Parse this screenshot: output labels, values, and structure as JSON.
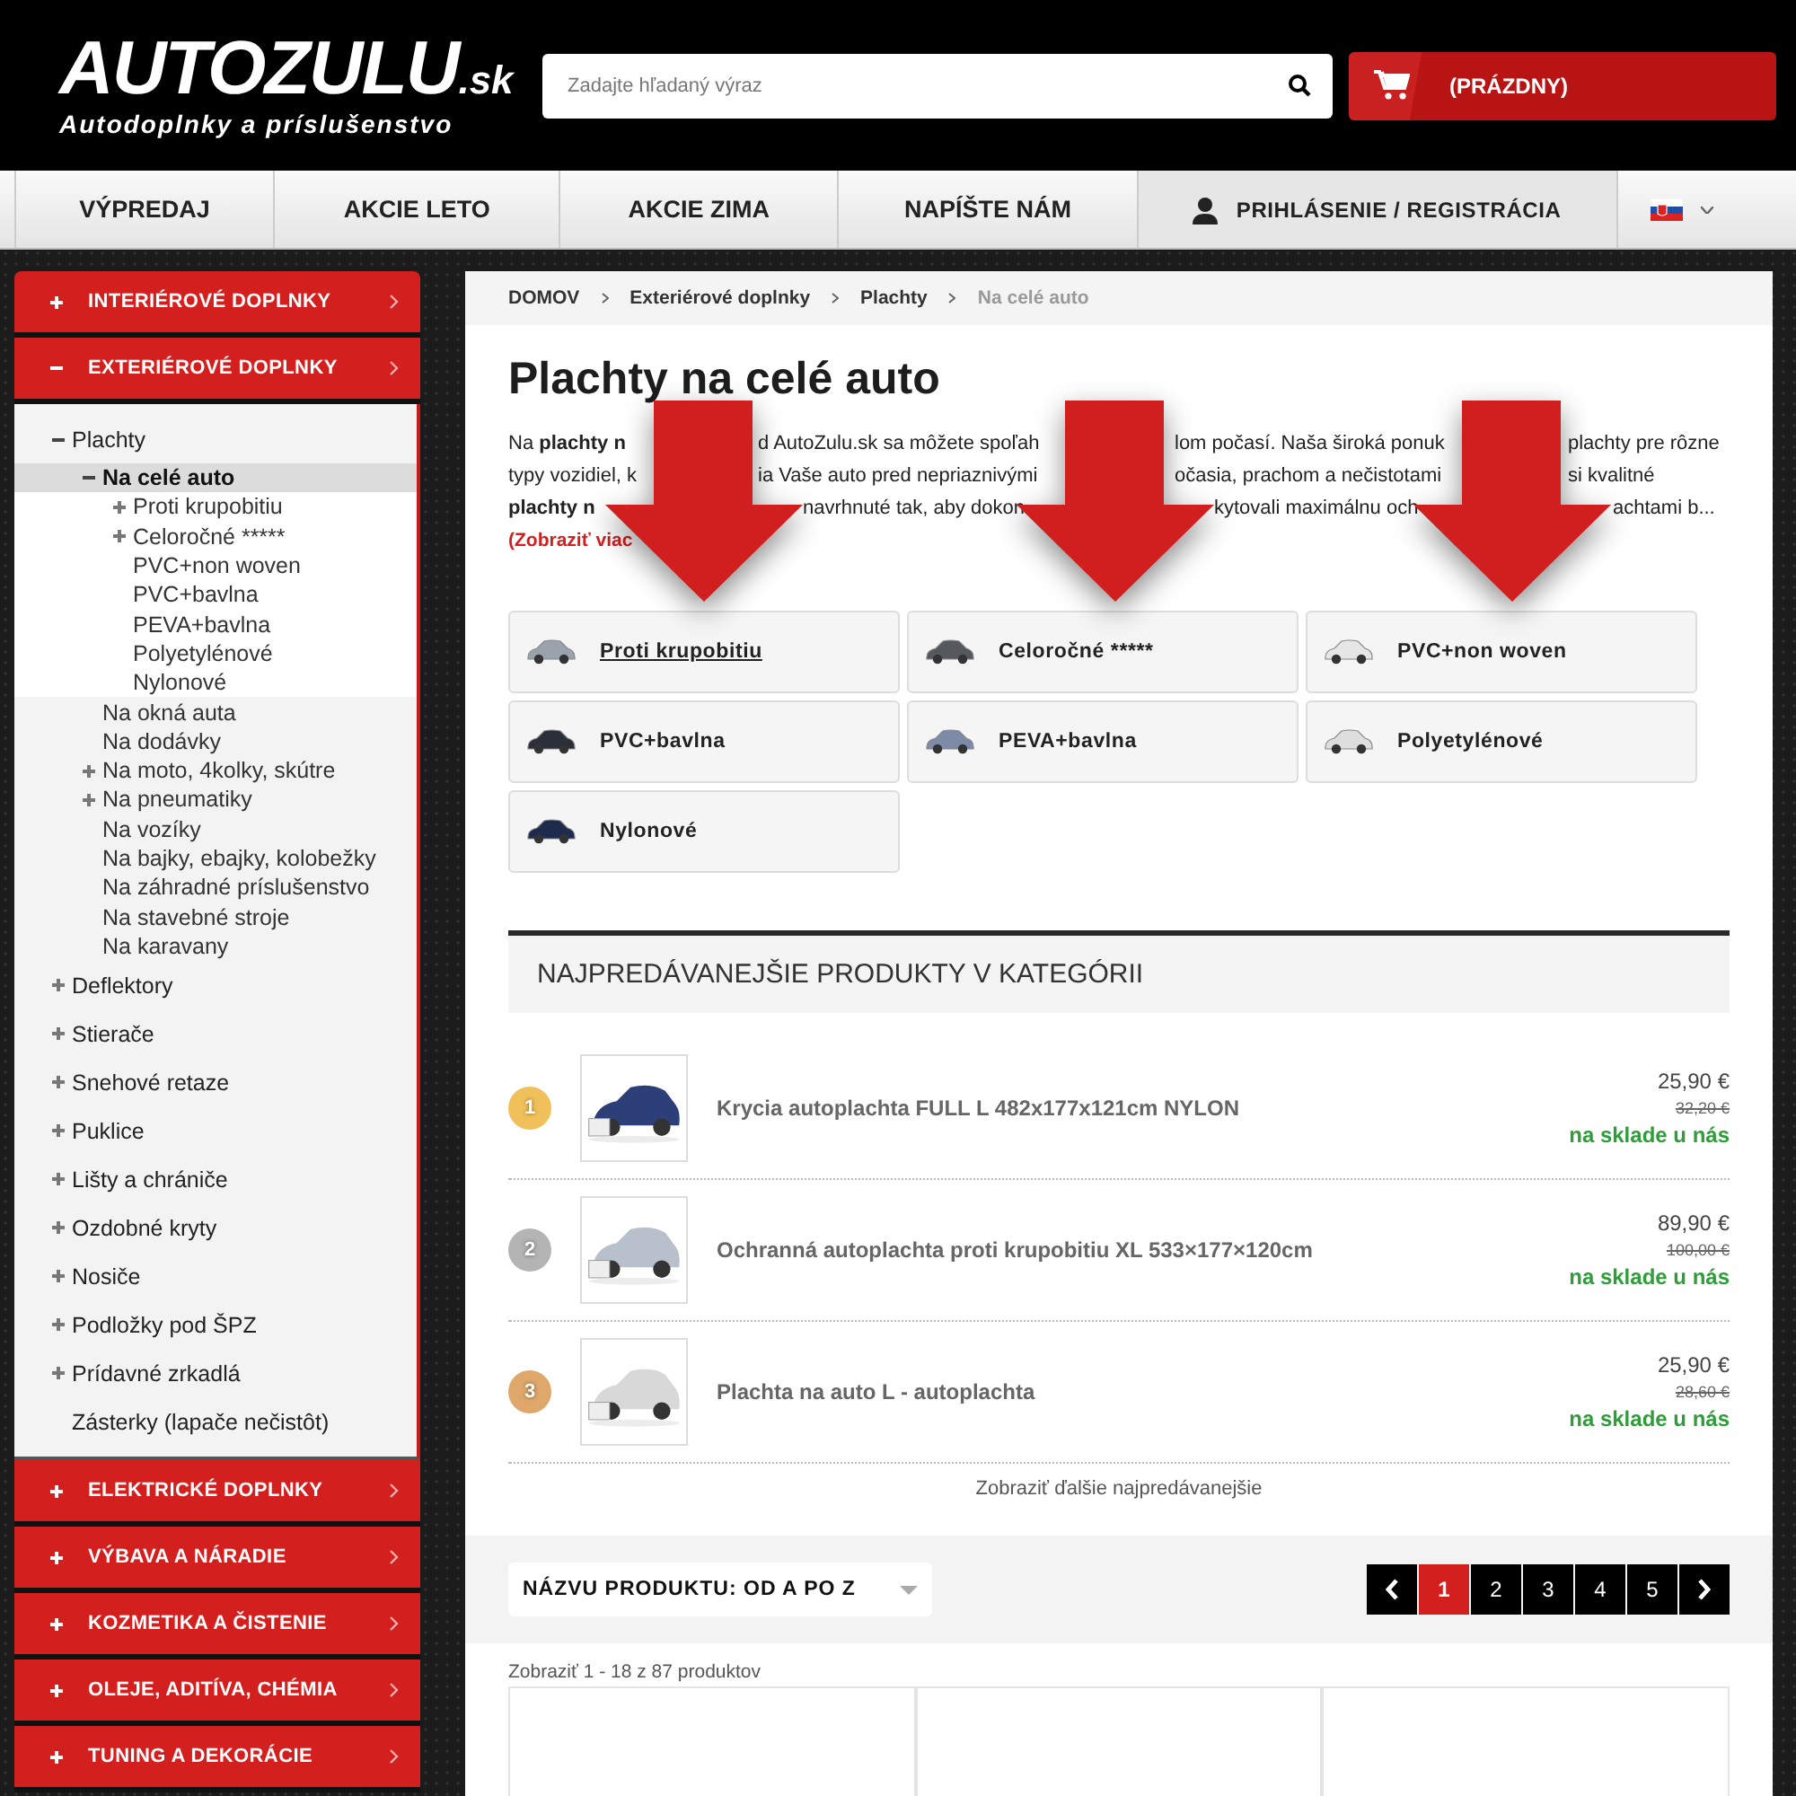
{
  "header": {
    "logo": {
      "name": "AUTOZULU",
      "domain": ".sk",
      "tagline": "Autodoplnky a príslušenstvo"
    },
    "search": {
      "placeholder": "Zadajte hľadaný výraz"
    },
    "cart": {
      "label": "(PRÁZDNY)"
    }
  },
  "nav": {
    "items": [
      "VÝPREDAJ",
      "AKCIE LETO",
      "AKCIE ZIMA",
      "NAPÍŠTE NÁM"
    ],
    "login": "PRIHLÁSENIE / REGISTRÁCIA"
  },
  "sidebar": {
    "categories": [
      {
        "label": "INTERIÉROVÉ DOPLNKY",
        "expanded": false
      },
      {
        "label": "EXTERIÉROVÉ DOPLNKY",
        "expanded": true,
        "children": [
          {
            "label": "Plachty",
            "kind": "folder",
            "expanded": true,
            "selected": false,
            "children": [
              {
                "label": "Na celé auto",
                "kind": "folder",
                "expanded": true,
                "selected": true,
                "children": [
                  {
                    "label": "Proti krupobitiu",
                    "kind": "folder",
                    "expanded": false,
                    "selected": false
                  },
                  {
                    "label": "Celoročné *****",
                    "kind": "folder",
                    "expanded": false,
                    "selected": false
                  },
                  {
                    "label": "PVC+non woven",
                    "kind": "leaf",
                    "expanded": false,
                    "selected": false
                  },
                  {
                    "label": "PVC+bavlna",
                    "kind": "leaf",
                    "expanded": false,
                    "selected": false
                  },
                  {
                    "label": "PEVA+bavlna",
                    "kind": "leaf",
                    "expanded": false,
                    "selected": false
                  },
                  {
                    "label": "Polyetylénové",
                    "kind": "leaf",
                    "expanded": false,
                    "selected": false
                  },
                  {
                    "label": "Nylonové",
                    "kind": "leaf",
                    "expanded": false,
                    "selected": false
                  }
                ]
              },
              {
                "label": "Na okná auta",
                "kind": "leaf",
                "expanded": false,
                "selected": false
              },
              {
                "label": "Na dodávky",
                "kind": "leaf",
                "expanded": false,
                "selected": false
              },
              {
                "label": "Na moto, 4kolky, skútre",
                "kind": "folder",
                "expanded": false,
                "selected": false
              },
              {
                "label": "Na pneumatiky",
                "kind": "folder",
                "expanded": false,
                "selected": false
              },
              {
                "label": "Na vozíky",
                "kind": "leaf",
                "expanded": false,
                "selected": false
              },
              {
                "label": "Na bajky, ebajky, kolobežky",
                "kind": "leaf",
                "expanded": false,
                "selected": false
              },
              {
                "label": "Na záhradné príslušenstvo",
                "kind": "leaf",
                "expanded": false,
                "selected": false
              },
              {
                "label": "Na stavebné stroje",
                "kind": "leaf",
                "expanded": false,
                "selected": false
              },
              {
                "label": "Na karavany",
                "kind": "leaf",
                "expanded": false,
                "selected": false
              }
            ]
          },
          {
            "label": "Deflektory",
            "kind": "folder",
            "expanded": false,
            "selected": false
          },
          {
            "label": "Stierače",
            "kind": "folder",
            "expanded": false,
            "selected": false
          },
          {
            "label": "Snehové retaze",
            "kind": "folder",
            "expanded": false,
            "selected": false
          },
          {
            "label": "Puklice",
            "kind": "folder",
            "expanded": false,
            "selected": false
          },
          {
            "label": "Lišty a chrániče",
            "kind": "folder",
            "expanded": false,
            "selected": false
          },
          {
            "label": "Ozdobné kryty",
            "kind": "folder",
            "expanded": false,
            "selected": false
          },
          {
            "label": "Nosiče",
            "kind": "folder",
            "expanded": false,
            "selected": false
          },
          {
            "label": "Podložky pod ŠPZ",
            "kind": "folder",
            "expanded": false,
            "selected": false
          },
          {
            "label": "Prídavné zrkadlá",
            "kind": "folder",
            "expanded": false,
            "selected": false
          },
          {
            "label": "Zásterky (lapače nečistôt)",
            "kind": "leaf",
            "expanded": false,
            "selected": false
          }
        ]
      },
      {
        "label": "ELEKTRICKÉ DOPLNKY",
        "expanded": false
      },
      {
        "label": "VÝBAVA A NÁRADIE",
        "expanded": false
      },
      {
        "label": "KOZMETIKA A ČISTENIE",
        "expanded": false
      },
      {
        "label": "OLEJE, ADITÍVA, CHÉMIA",
        "expanded": false
      },
      {
        "label": "TUNING A DEKORÁCIE",
        "expanded": false
      }
    ]
  },
  "breadcrumb": [
    {
      "label": "DOMOV",
      "current": false
    },
    {
      "label": "Exteriérové doplnky",
      "current": false
    },
    {
      "label": "Plachty",
      "current": false
    },
    {
      "label": "Na celé auto",
      "current": true
    }
  ],
  "title": "Plachty na celé auto",
  "description": {
    "lines": [
      [
        "Na **plachty n**",
        "d AutoZulu.sk sa môžete spoľah",
        "lom počasí. Naša široká ponuk",
        "plachty pre rôzne"
      ],
      [
        "typy vozidiel, k",
        "ia Vaše auto pred nepriaznivými",
        "očasia, prachom a nečistotami",
        "si kvalitné"
      ],
      [
        "**plachty n**",
        "navrhnuté tak, aby dokon",
        "kytovali maximálnu och",
        "achtami b..."
      ]
    ],
    "more": "(Zobraziť viac"
  },
  "subcategories": [
    {
      "label": "Proti krupobitiu",
      "hovered": true
    },
    {
      "label": "Celoročné *****",
      "hovered": false
    },
    {
      "label": "PVC+non woven",
      "hovered": false
    },
    {
      "label": "PVC+bavlna",
      "hovered": false
    },
    {
      "label": "PEVA+bavlna",
      "hovered": false
    },
    {
      "label": "Polyetylénové",
      "hovered": false
    },
    {
      "label": "Nylonové",
      "hovered": false
    }
  ],
  "bestsellers": {
    "heading": "NAJPREDÁVANEJŠIE PRODUKTY V KATEGÓRII",
    "items": [
      {
        "rank": "1",
        "color": "#f0c05a",
        "name": "Krycia autoplachta FULL L 482x177x121cm NYLON",
        "price": "25,90 €",
        "old_price": "32,20 €",
        "stock": "na sklade u nás"
      },
      {
        "rank": "2",
        "color": "#b4b4b4",
        "name": "Ochranná autoplachta proti krupobitiu XL 533×177×120cm",
        "price": "89,90 €",
        "old_price": "100,00 €",
        "stock": "na sklade u nás"
      },
      {
        "rank": "3",
        "color": "#dfa86a",
        "name": "Plachta na auto L - autoplachta",
        "price": "25,90 €",
        "old_price": "28,60 €",
        "stock": "na sklade u nás"
      }
    ],
    "more": "Zobraziť ďalšie najpredávanejšie"
  },
  "toolbar": {
    "sort": "NÁZVU PRODUKTU: OD A PO Z",
    "pages": [
      {
        "label": "1",
        "selected": true
      },
      {
        "label": "2",
        "selected": false
      },
      {
        "label": "3",
        "selected": false
      },
      {
        "label": "4",
        "selected": false
      },
      {
        "label": "5",
        "selected": false
      }
    ]
  },
  "count": "Zobraziť 1 - 18 z 87 produktov"
}
